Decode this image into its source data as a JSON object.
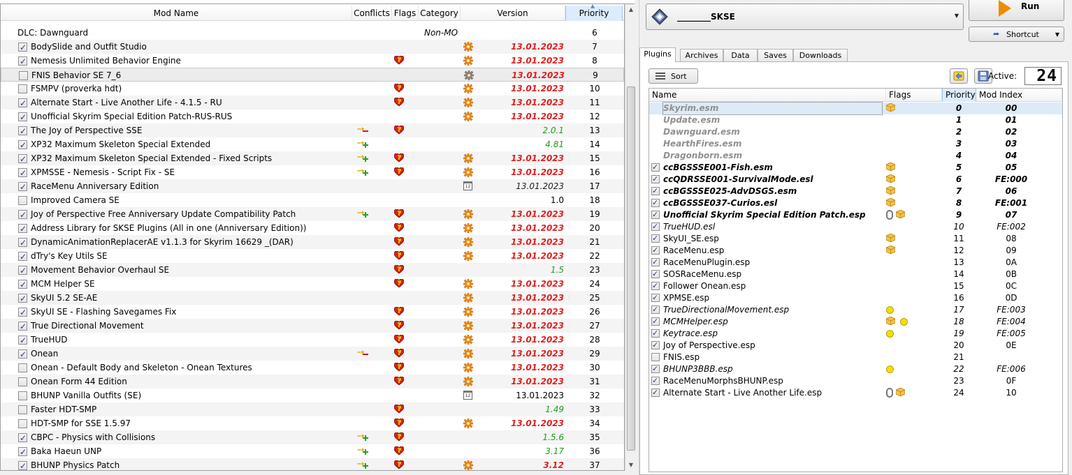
{
  "modlist": {
    "columns": {
      "name": "Mod Name",
      "conflicts": "Conflicts",
      "flags": "Flags",
      "category": "Category",
      "version": "Version",
      "priority": "Priority"
    },
    "rows": [
      {
        "name": "DLC: Dawnguard",
        "checkbox": false,
        "has_checkbox": false,
        "category": "Non-MO",
        "version": "",
        "priority": "6"
      },
      {
        "name": "BodySlide and Outfit Studio",
        "checkbox": true,
        "has_checkbox": true,
        "gear": true,
        "version": "13.01.2023",
        "vstyle": "red",
        "priority": "7"
      },
      {
        "name": "Nemesis Unlimited Behavior Engine",
        "checkbox": true,
        "has_checkbox": true,
        "flag": true,
        "gear": true,
        "version": "13.01.2023",
        "vstyle": "red",
        "priority": "8"
      },
      {
        "name": "FNIS Behavior SE 7_6",
        "checkbox": false,
        "has_checkbox": true,
        "gear": true,
        "gear_grey": true,
        "version": "13.01.2023",
        "vstyle": "red",
        "priority": "9",
        "selected": true
      },
      {
        "name": "FSMPV (proverka hdt)",
        "checkbox": false,
        "has_checkbox": true,
        "flag": true,
        "gear": true,
        "version": "13.01.2023",
        "vstyle": "red",
        "priority": "10"
      },
      {
        "name": "Alternate Start - Live Another Life - 4.1.5 - RU",
        "checkbox": true,
        "has_checkbox": true,
        "flag": true,
        "gear": true,
        "version": "13.01.2023",
        "vstyle": "red",
        "priority": "11"
      },
      {
        "name": "Unofficial Skyrim Special Edition Patch-RUS-RUS",
        "checkbox": true,
        "has_checkbox": true,
        "gear": true,
        "version": "13.01.2023",
        "vstyle": "red",
        "priority": "12"
      },
      {
        "name": "The Joy of Perspective SSE",
        "checkbox": true,
        "has_checkbox": true,
        "conflict": "red",
        "flag": true,
        "version": "2.0.1",
        "vstyle": "green",
        "priority": "13"
      },
      {
        "name": "XP32 Maximum Skeleton Special Extended",
        "checkbox": true,
        "has_checkbox": true,
        "conflict": "green",
        "version": "4.81",
        "vstyle": "green",
        "priority": "14"
      },
      {
        "name": "XP32 Maximum Skeleton Special Extended - Fixed Scripts",
        "checkbox": true,
        "has_checkbox": true,
        "conflict": "both",
        "flag": true,
        "gear": true,
        "version": "13.01.2023",
        "vstyle": "red",
        "priority": "15"
      },
      {
        "name": "XPMSSE - Nemesis - Script Fix - SE",
        "checkbox": true,
        "has_checkbox": true,
        "conflict": "green",
        "flag": true,
        "gear": true,
        "version": "13.01.2023",
        "vstyle": "red",
        "priority": "16"
      },
      {
        "name": "RaceMenu Anniversary Edition",
        "checkbox": true,
        "has_checkbox": true,
        "calendar": true,
        "version": "13.01.2023",
        "vstyle": "greyit",
        "priority": "17"
      },
      {
        "name": "Improved Camera SE",
        "checkbox": false,
        "has_checkbox": true,
        "version": "1.0",
        "vstyle": "plain",
        "priority": "18"
      },
      {
        "name": "Joy of Perspective Free Anniversary Update Compatibility Patch",
        "checkbox": true,
        "has_checkbox": true,
        "conflict": "green",
        "flag": true,
        "gear": true,
        "version": "13.01.2023",
        "vstyle": "red",
        "priority": "19"
      },
      {
        "name": "Address Library for SKSE Plugins (All in one (Anniversary Edition))",
        "checkbox": true,
        "has_checkbox": true,
        "flag": true,
        "gear": true,
        "version": "13.01.2023",
        "vstyle": "red",
        "priority": "20"
      },
      {
        "name": "DynamicAnimationReplacerAE v1.1.3 for Skyrim 16629 _(DAR)",
        "checkbox": true,
        "has_checkbox": true,
        "flag": true,
        "gear": true,
        "version": "13.01.2023",
        "vstyle": "red",
        "priority": "21"
      },
      {
        "name": "dTry's Key Utils SE",
        "checkbox": true,
        "has_checkbox": true,
        "flag": true,
        "gear": true,
        "version": "13.01.2023",
        "vstyle": "red",
        "priority": "22"
      },
      {
        "name": "Movement Behavior Overhaul SE",
        "checkbox": true,
        "has_checkbox": true,
        "flag": true,
        "version": "1.5",
        "vstyle": "green",
        "priority": "23"
      },
      {
        "name": "MCM Helper SE",
        "checkbox": true,
        "has_checkbox": true,
        "flag": true,
        "gear": true,
        "version": "13.01.2023",
        "vstyle": "red",
        "priority": "24"
      },
      {
        "name": "SkyUI 5.2 SE-AE",
        "checkbox": true,
        "has_checkbox": true,
        "gear": true,
        "version": "13.01.2023",
        "vstyle": "red",
        "priority": "25"
      },
      {
        "name": "SkyUI SE - Flashing Savegames Fix",
        "checkbox": true,
        "has_checkbox": true,
        "flag": true,
        "gear": true,
        "version": "13.01.2023",
        "vstyle": "red",
        "priority": "26"
      },
      {
        "name": "True Directional Movement",
        "checkbox": true,
        "has_checkbox": true,
        "flag": true,
        "gear": true,
        "version": "13.01.2023",
        "vstyle": "red",
        "priority": "27"
      },
      {
        "name": "TrueHUD",
        "checkbox": true,
        "has_checkbox": true,
        "flag": true,
        "gear": true,
        "version": "13.01.2023",
        "vstyle": "red",
        "priority": "28"
      },
      {
        "name": "Onean",
        "checkbox": true,
        "has_checkbox": true,
        "conflict": "red",
        "flag": true,
        "gear": true,
        "version": "13.01.2023",
        "vstyle": "red",
        "priority": "29"
      },
      {
        "name": "Onean - Default Body and Skeleton - Onean Textures",
        "checkbox": false,
        "has_checkbox": true,
        "flag": true,
        "gear": true,
        "version": "13.01.2023",
        "vstyle": "red",
        "priority": "30"
      },
      {
        "name": "Onean Form 44 Edition",
        "checkbox": false,
        "has_checkbox": true,
        "flag": true,
        "gear": true,
        "version": "13.01.2023",
        "vstyle": "red",
        "priority": "31"
      },
      {
        "name": "BHUNP Vanilla Outfits (SE)",
        "checkbox": false,
        "has_checkbox": true,
        "calendar": true,
        "version": "13.01.2023",
        "vstyle": "plain",
        "priority": "32"
      },
      {
        "name": "Faster HDT-SMP",
        "checkbox": false,
        "has_checkbox": true,
        "flag": true,
        "version": "1.49",
        "vstyle": "green",
        "priority": "33"
      },
      {
        "name": "HDT-SMP for SSE 1.5.97",
        "checkbox": false,
        "has_checkbox": true,
        "flag": true,
        "gear": true,
        "version": "13.01.2023",
        "vstyle": "red",
        "priority": "34"
      },
      {
        "name": "CBPC - Physics with Collisions",
        "checkbox": true,
        "has_checkbox": true,
        "conflict": "both",
        "flag": true,
        "version": "1.5.6",
        "vstyle": "green",
        "priority": "35"
      },
      {
        "name": "Baka Haeun UNP",
        "checkbox": true,
        "has_checkbox": true,
        "conflict": "green",
        "flag": true,
        "version": "3.17",
        "vstyle": "green",
        "priority": "36"
      },
      {
        "name": "BHUNP Physics Patch",
        "checkbox": true,
        "has_checkbox": true,
        "conflict": "green",
        "flag": true,
        "gear": true,
        "version": "3.12",
        "vstyle": "red",
        "priority": "37"
      }
    ]
  },
  "executable": {
    "label": "________SKSE"
  },
  "run": {
    "label": "Run"
  },
  "shortcut": {
    "label": "Shortcut"
  },
  "tabs": [
    {
      "label": "Plugins",
      "active": true
    },
    {
      "label": "Archives"
    },
    {
      "label": "Data"
    },
    {
      "label": "Saves"
    },
    {
      "label": "Downloads"
    }
  ],
  "plugins": {
    "sort_label": "Sort",
    "active_label": "Active:",
    "active_count": "24",
    "columns": {
      "name": "Name",
      "flags": "Flags",
      "priority": "Priority",
      "mod_index": "Mod Index"
    },
    "rows": [
      {
        "name": "Skyrim.esm",
        "style": "master",
        "checkbox": false,
        "has_checkbox": false,
        "flags": [
          "box"
        ],
        "priority": "0",
        "index": "00",
        "istyle": "bi",
        "selected": true
      },
      {
        "name": "Update.esm",
        "style": "master",
        "checkbox": false,
        "has_checkbox": false,
        "flags": [],
        "priority": "1",
        "index": "01",
        "istyle": "bi"
      },
      {
        "name": "Dawnguard.esm",
        "style": "master",
        "checkbox": false,
        "has_checkbox": false,
        "flags": [],
        "priority": "2",
        "index": "02",
        "istyle": "bi"
      },
      {
        "name": "HearthFires.esm",
        "style": "master",
        "checkbox": false,
        "has_checkbox": false,
        "flags": [],
        "priority": "3",
        "index": "03",
        "istyle": "bi"
      },
      {
        "name": "Dragonborn.esm",
        "style": "master",
        "checkbox": false,
        "has_checkbox": false,
        "flags": [],
        "priority": "4",
        "index": "04",
        "istyle": "bi"
      },
      {
        "name": "ccBGSSSE001-Fish.esm",
        "style": "bi",
        "checkbox": true,
        "has_checkbox": true,
        "flags": [
          "box"
        ],
        "priority": "5",
        "index": "05",
        "istyle": "bi"
      },
      {
        "name": "ccQDRSSE001-SurvivalMode.esl",
        "style": "bi",
        "checkbox": true,
        "has_checkbox": true,
        "flags": [
          "box"
        ],
        "priority": "6",
        "index": "FE:000",
        "istyle": "bi"
      },
      {
        "name": "ccBGSSSE025-AdvDSGS.esm",
        "style": "bi",
        "checkbox": true,
        "has_checkbox": true,
        "flags": [
          "box"
        ],
        "priority": "7",
        "index": "06",
        "istyle": "bi"
      },
      {
        "name": "ccBGSSSE037-Curios.esl",
        "style": "bi",
        "checkbox": true,
        "has_checkbox": true,
        "flags": [
          "box"
        ],
        "priority": "8",
        "index": "FE:001",
        "istyle": "bi"
      },
      {
        "name": "Unofficial Skyrim Special Edition Patch.esp",
        "style": "bi",
        "checkbox": true,
        "has_checkbox": true,
        "flags": [
          "clip",
          "box"
        ],
        "priority": "9",
        "index": "07",
        "istyle": "bi"
      },
      {
        "name": "TrueHUD.esl",
        "style": "it",
        "checkbox": true,
        "has_checkbox": true,
        "flags": [],
        "priority": "10",
        "index": "FE:002",
        "istyle": "it"
      },
      {
        "name": "SkyUI_SE.esp",
        "style": "plain",
        "checkbox": true,
        "has_checkbox": true,
        "flags": [
          "box"
        ],
        "priority": "11",
        "index": "08",
        "istyle": "plain"
      },
      {
        "name": "RaceMenu.esp",
        "style": "plain",
        "checkbox": true,
        "has_checkbox": true,
        "flags": [
          "box"
        ],
        "priority": "12",
        "index": "09",
        "istyle": "plain"
      },
      {
        "name": "RaceMenuPlugin.esp",
        "style": "plain",
        "checkbox": true,
        "has_checkbox": true,
        "flags": [],
        "priority": "13",
        "index": "0A",
        "istyle": "plain"
      },
      {
        "name": "SOSRaceMenu.esp",
        "style": "plain",
        "checkbox": true,
        "has_checkbox": true,
        "flags": [],
        "priority": "14",
        "index": "0B",
        "istyle": "plain"
      },
      {
        "name": "Follower Onean.esp",
        "style": "plain",
        "checkbox": true,
        "has_checkbox": true,
        "flags": [],
        "priority": "15",
        "index": "0C",
        "istyle": "plain"
      },
      {
        "name": "XPMSE.esp",
        "style": "plain",
        "checkbox": true,
        "has_checkbox": true,
        "flags": [],
        "priority": "16",
        "index": "0D",
        "istyle": "plain"
      },
      {
        "name": "TrueDirectionalMovement.esp",
        "style": "it",
        "checkbox": true,
        "has_checkbox": true,
        "flags": [
          "dot"
        ],
        "priority": "17",
        "index": "FE:003",
        "istyle": "it"
      },
      {
        "name": "MCMHelper.esp",
        "style": "it",
        "checkbox": true,
        "has_checkbox": true,
        "flags": [
          "box",
          "dot"
        ],
        "priority": "18",
        "index": "FE:004",
        "istyle": "it"
      },
      {
        "name": "Keytrace.esp",
        "style": "it",
        "checkbox": true,
        "has_checkbox": true,
        "flags": [
          "dot"
        ],
        "priority": "19",
        "index": "FE:005",
        "istyle": "it"
      },
      {
        "name": "Joy of Perspective.esp",
        "style": "plain",
        "checkbox": true,
        "has_checkbox": true,
        "flags": [],
        "priority": "20",
        "index": "0E",
        "istyle": "plain"
      },
      {
        "name": "FNIS.esp",
        "style": "plain",
        "checkbox": false,
        "has_checkbox": true,
        "flags": [],
        "priority": "21",
        "index": "",
        "istyle": "plain"
      },
      {
        "name": "BHUNP3BBB.esp",
        "style": "it",
        "checkbox": true,
        "has_checkbox": true,
        "flags": [
          "dot"
        ],
        "priority": "22",
        "index": "FE:006",
        "istyle": "it"
      },
      {
        "name": "RaceMenuMorphsBHUNP.esp",
        "style": "plain",
        "checkbox": true,
        "has_checkbox": true,
        "flags": [],
        "priority": "23",
        "index": "0F",
        "istyle": "plain"
      },
      {
        "name": "Alternate Start - Live Another Life.esp",
        "style": "plain",
        "checkbox": true,
        "has_checkbox": true,
        "flags": [
          "clip",
          "box"
        ],
        "priority": "24",
        "index": "10",
        "istyle": "plain"
      }
    ]
  }
}
